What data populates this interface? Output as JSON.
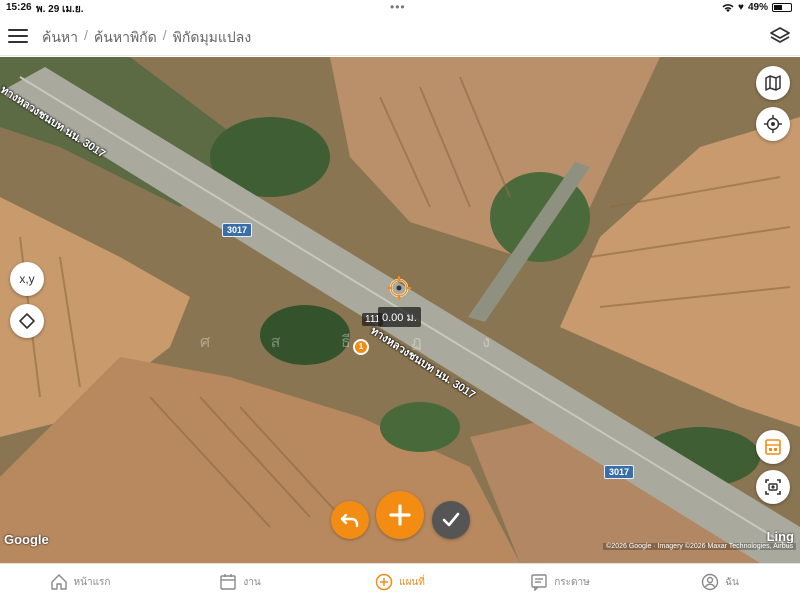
{
  "status": {
    "time": "15:26",
    "date": "พ. 29 เม.ย.",
    "battery": "49%",
    "battery_level": 0.49
  },
  "header": {
    "breadcrumb": [
      "ค้นหา",
      "ค้นหาพิกัด",
      "พิกัดมุมแปลง"
    ]
  },
  "map": {
    "road_shields": [
      "3017",
      "3017"
    ],
    "road_label_top": "ทางหลวงชนบท นน. 3017",
    "road_label_main": "ทางหลวงชนบท นน. 3017",
    "faint_label": "ศ ส ธี ฏ ง",
    "measurement": "0.00 ม.",
    "point_tag": "111",
    "point_number": "1",
    "coord_button_label": "x,y",
    "google_logo": "Google",
    "attribution": "©2026 Google · Imagery ©2026 Maxar Technologies, Airbus",
    "ling": "Ling"
  },
  "bottom_nav": [
    {
      "label": "หน้าแรก",
      "icon": "home-icon"
    },
    {
      "label": "งาน",
      "icon": "calendar-icon"
    },
    {
      "label": "แผนที่",
      "icon": "add-circle-icon"
    },
    {
      "label": "กระดาษ",
      "icon": "list-icon"
    },
    {
      "label": "ฉัน",
      "icon": "person-icon"
    }
  ],
  "colors": {
    "accent": "#f28c13",
    "confirm": "#555555",
    "road_shield": "#3a6ea8"
  }
}
